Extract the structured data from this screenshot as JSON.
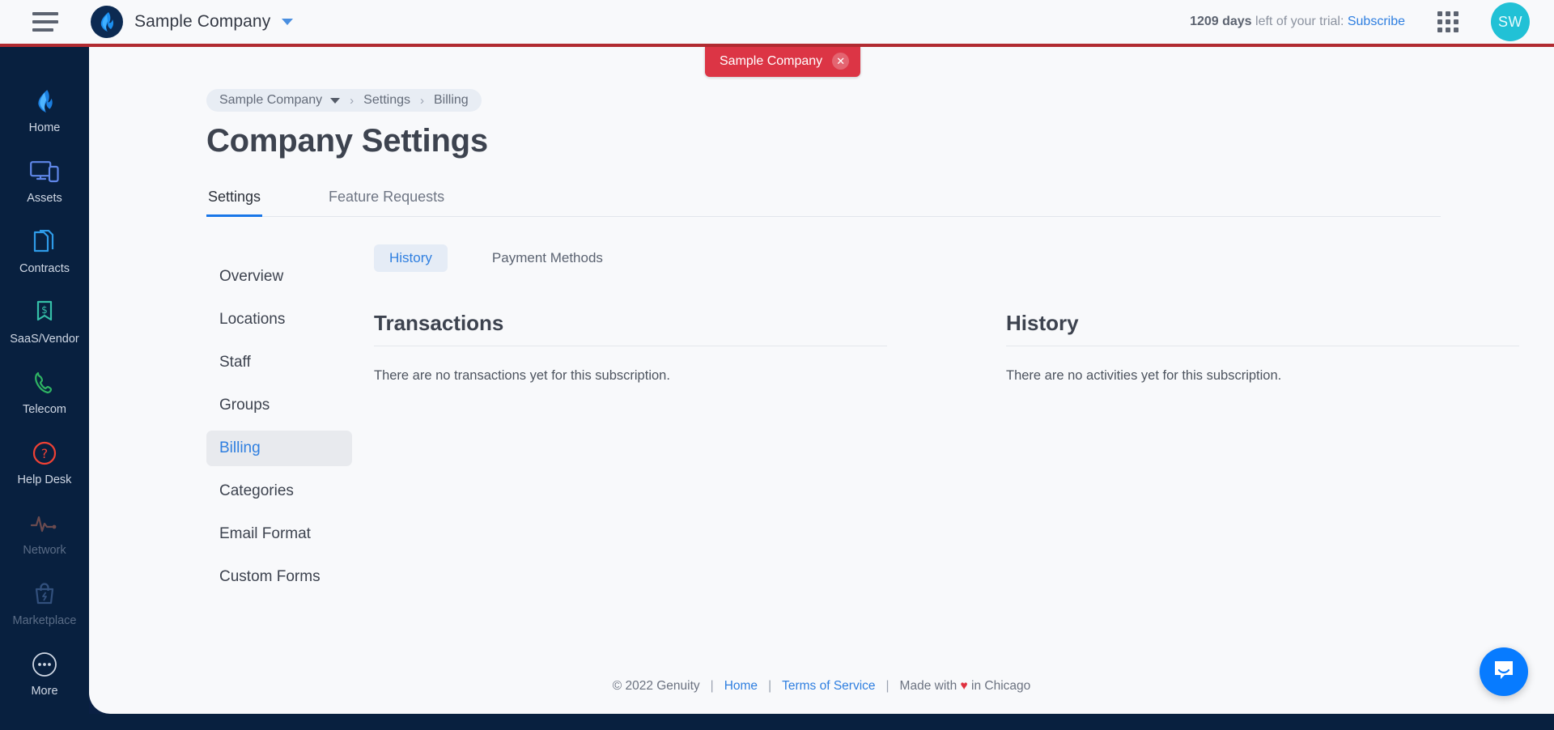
{
  "header": {
    "menu_icon": "hamburger-menu-icon",
    "logo_icon": "genuity-flame-logo",
    "company_name": "Sample Company",
    "company_caret_icon": "chevron-down-icon",
    "trial_days": "1209 days",
    "trial_text": " left of your trial: ",
    "subscribe_label": "Subscribe",
    "apps_icon": "app-grid-icon",
    "avatar_initials": "SW",
    "accent_red": "#b12b31",
    "avatar_color": "#21c1d6"
  },
  "sidenav": {
    "items": [
      {
        "label": "Home",
        "icon": "flame-icon",
        "dim": false
      },
      {
        "label": "Assets",
        "icon": "monitor-phone-icon",
        "dim": false
      },
      {
        "label": "Contracts",
        "icon": "documents-icon",
        "dim": false
      },
      {
        "label": "SaaS/Vendor",
        "icon": "dollar-ribbon-icon",
        "dim": false
      },
      {
        "label": "Telecom",
        "icon": "phone-handset-icon",
        "dim": false
      },
      {
        "label": "Help Desk",
        "icon": "question-circle-icon",
        "dim": false
      },
      {
        "label": "Network",
        "icon": "pulse-wave-icon",
        "dim": true
      },
      {
        "label": "Marketplace",
        "icon": "shopping-bag-icon",
        "dim": true
      },
      {
        "label": "More",
        "icon": "ellipsis-circle-icon",
        "dim": false
      }
    ]
  },
  "tag_badge": {
    "label": "Sample Company",
    "close_icon": "close-icon",
    "color": "#dc3545"
  },
  "breadcrumb": {
    "company": "Sample Company",
    "caret_icon": "caret-down-icon",
    "separator": "›",
    "settings": "Settings",
    "billing": "Billing"
  },
  "page_title": "Company Settings",
  "tabs": [
    {
      "label": "Settings",
      "active": true
    },
    {
      "label": "Feature Requests",
      "active": false
    }
  ],
  "settings_menu": [
    {
      "label": "Overview",
      "active": false
    },
    {
      "label": "Locations",
      "active": false
    },
    {
      "label": "Staff",
      "active": false
    },
    {
      "label": "Groups",
      "active": false
    },
    {
      "label": "Billing",
      "active": true
    },
    {
      "label": "Categories",
      "active": false
    },
    {
      "label": "Email Format",
      "active": false
    },
    {
      "label": "Custom Forms",
      "active": false
    }
  ],
  "subtabs": [
    {
      "label": "History",
      "active": true
    },
    {
      "label": "Payment Methods",
      "active": false
    }
  ],
  "panels": {
    "transactions": {
      "title": "Transactions",
      "empty_text": "There are no transactions yet for this subscription."
    },
    "history": {
      "title": "History",
      "empty_text": "There are no activities yet for this subscription."
    }
  },
  "footer": {
    "copyright": "© 2022 Genuity",
    "home": "Home",
    "terms": "Terms of Service",
    "made_with_pre": "Made with ",
    "heart": "♥",
    "made_with_post": " in Chicago",
    "sep": "|"
  },
  "chat": {
    "icon": "chat-bubble-icon",
    "color": "#077bff"
  }
}
